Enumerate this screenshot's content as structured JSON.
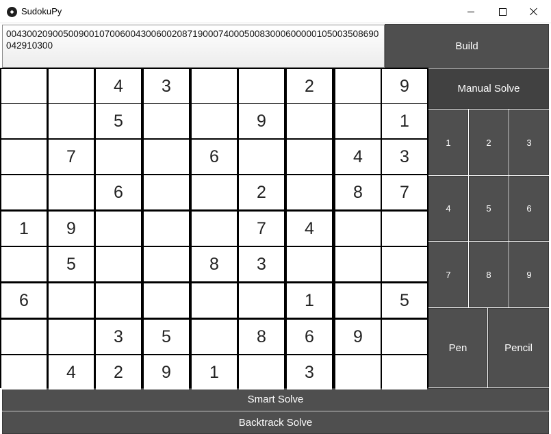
{
  "window": {
    "title": "SudokuPy"
  },
  "puzzle_input": {
    "value": "004300209005009001070060043006002087190007400050083000600000105003508690042910300"
  },
  "buttons": {
    "build": "Build",
    "manual_solve": "Manual Solve",
    "numbers": [
      "1",
      "2",
      "3",
      "4",
      "5",
      "6",
      "7",
      "8",
      "9"
    ],
    "pen": "Pen",
    "pencil": "Pencil",
    "smart_solve": "Smart Solve",
    "backtrack_solve": "Backtrack Solve"
  },
  "grid": [
    [
      "",
      "",
      "4",
      "3",
      "",
      "",
      "2",
      "",
      "9"
    ],
    [
      "",
      "",
      "5",
      "",
      "",
      "9",
      "",
      "",
      "1"
    ],
    [
      "",
      "7",
      "",
      "",
      "6",
      "",
      "",
      "4",
      "3"
    ],
    [
      "",
      "",
      "6",
      "",
      "",
      "2",
      "",
      "8",
      "7"
    ],
    [
      "1",
      "9",
      "",
      "",
      "",
      "7",
      "4",
      "",
      ""
    ],
    [
      "",
      "5",
      "",
      "",
      "8",
      "3",
      "",
      "",
      ""
    ],
    [
      "6",
      "",
      "",
      "",
      "",
      "",
      "1",
      "",
      "5"
    ],
    [
      "",
      "",
      "3",
      "5",
      "",
      "8",
      "6",
      "9",
      ""
    ],
    [
      "",
      "4",
      "2",
      "9",
      "1",
      "",
      "3",
      "",
      ""
    ]
  ],
  "colors": {
    "button_bg": "#4f4f4f",
    "button_active_bg": "#414141",
    "grid_line": "#000000"
  }
}
